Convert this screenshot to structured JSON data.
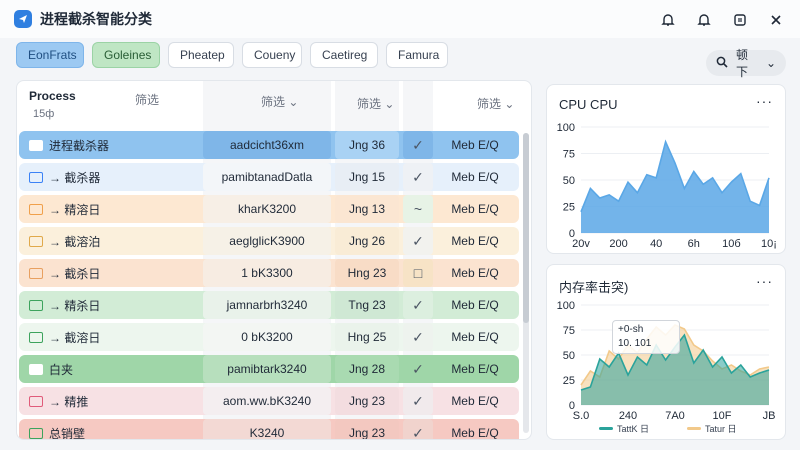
{
  "app": {
    "title": "进程截杀智能分类"
  },
  "tabs": [
    "EonFrats",
    "Goleines",
    "Pheatep",
    "Coueny",
    "Caetireg",
    "Famura"
  ],
  "search": {
    "label": "顿下"
  },
  "table": {
    "header": {
      "process": "Process",
      "process_sub": "15ф",
      "c1": "筛选",
      "c2": "筛选 ⌄",
      "c3": "筛选 ⌄",
      "c4": "筛选 ⌄"
    },
    "rows": [
      {
        "icon": "window-icon",
        "icon_color": "#ffffff",
        "name": "进程截杀器",
        "mid": "aadcicht36xm",
        "date": "Jng 36",
        "check": "✓",
        "status": "Meb E/Q",
        "bg": "#8fc3ef",
        "mid_bg": "#7fb6e8",
        "date_bg": "#a9d2f4",
        "check_bg": "#7fb6e8"
      },
      {
        "icon": "checkbox-icon",
        "icon_color": "#3b82f6",
        "name": "→ 截杀器",
        "mid": "pamibtanadDatla",
        "date": "Jng 15",
        "check": "✓",
        "status": "Meb E/Q",
        "bg": "#e6f0fb",
        "mid_bg": "#f3f6f9",
        "date_bg": "#e8eef5",
        "check_bg": "#eef1f5"
      },
      {
        "icon": "tag-icon",
        "icon_color": "#f0a04b",
        "name": "→ 精溶日",
        "mid": "kharK3200",
        "date": "Jng 13",
        "check": "~",
        "status": "Meb E/Q",
        "bg": "#fde8d2",
        "mid_bg": "#f7efe6",
        "date_bg": "#fbe6d2",
        "check_bg": "#e7f3e6"
      },
      {
        "icon": "tag-icon",
        "icon_color": "#e0a94a",
        "name": "→ 截溶泊",
        "mid": "aeglglicK3900",
        "date": "Jng 26",
        "check": "✓",
        "status": "Meb E/Q",
        "bg": "#fbf0dc",
        "mid_bg": "#f6f1e7",
        "date_bg": "#f9ecd6",
        "check_bg": "#f2f2ee"
      },
      {
        "icon": "square-icon",
        "icon_color": "#e8a060",
        "name": "→ 截杀日",
        "mid": "1 bK3300",
        "date": "Hng 23",
        "check": "□",
        "status": "Meb E/Q",
        "bg": "#fbe3d0",
        "mid_bg": "#f7ece2",
        "date_bg": "#f8dcc6",
        "check_bg": "#f7e3c6"
      },
      {
        "icon": "list-icon",
        "icon_color": "#3da35d",
        "name": "→ 精杀日",
        "mid": "jamnarbrh3240",
        "date": "Tng 23",
        "check": "✓",
        "status": "Meb E/Q",
        "bg": "#d2ecd6",
        "mid_bg": "#e9f2ea",
        "date_bg": "#cfe8d4",
        "check_bg": "#dcefdf"
      },
      {
        "icon": "list-icon",
        "icon_color": "#3da35d",
        "name": "→ 截溶日",
        "mid": "0 bK3200",
        "date": "Hng 25",
        "check": "✓",
        "status": "Meb E/Q",
        "bg": "#edf6ee",
        "mid_bg": "#f3f6f3",
        "date_bg": "#eaf3eb",
        "check_bg": "#eef3ee"
      },
      {
        "icon": "window-icon",
        "icon_color": "#ffffff",
        "name": "白夹",
        "mid": "pamibtark3240",
        "date": "Jng 28",
        "check": "✓",
        "status": "Meb E/Q",
        "bg": "#9fd6a8",
        "mid_bg": "#b7dfbd",
        "date_bg": "#a9dab1",
        "check_bg": "#9fd6a8"
      },
      {
        "icon": "flag-icon",
        "icon_color": "#e05b7a",
        "name": "→ 精推",
        "mid": "aom.ww.bK3240",
        "date": "Jng 23",
        "check": "✓",
        "status": "Meb E/Q",
        "bg": "#f7e1e4",
        "mid_bg": "#f4eef0",
        "date_bg": "#f3dde0",
        "check_bg": "#f1eaec"
      },
      {
        "icon": "flag-icon",
        "icon_color": "#3da35d",
        "name": "总销壁",
        "mid": "K3240",
        "date": "Jng 23",
        "check": "✓",
        "status": "Meb E/Q",
        "bg": "#f6c9c2",
        "mid_bg": "#f3d9d4",
        "date_bg": "#f3c8c0",
        "check_bg": "#f1d3cd"
      }
    ]
  },
  "cpu_card": {
    "title": "CPU CPU",
    "menu": "···"
  },
  "mem_card": {
    "title": "内存率击突)",
    "menu": "···"
  },
  "tooltip": {
    "line1": "+0-sh",
    "line2": "10. 101"
  },
  "chart_data": [
    {
      "type": "area",
      "title": "CPU CPU",
      "x_ticks": [
        "20v",
        "200",
        "40",
        "6h",
        "10б",
        "10¡"
      ],
      "y_ticks": [
        0,
        25,
        50,
        75,
        100
      ],
      "ylim": [
        0,
        100
      ],
      "series": [
        {
          "color": "#5aa7e6",
          "values": [
            20,
            42,
            33,
            36,
            30,
            48,
            38,
            55,
            52,
            86,
            66,
            42,
            58,
            46,
            52,
            38,
            48,
            56,
            30,
            26,
            52
          ]
        }
      ]
    },
    {
      "type": "area",
      "title": "内存率击突)",
      "x_ticks": [
        "S.0",
        "240",
        "7A0",
        "10F",
        "JB"
      ],
      "y_ticks": [
        0,
        25,
        50,
        75,
        100
      ],
      "ylim": [
        0,
        100
      ],
      "series": [
        {
          "name": "TattK 日",
          "color": "#2aa39b",
          "values": [
            15,
            18,
            46,
            38,
            52,
            30,
            48,
            40,
            60,
            45,
            58,
            70,
            42,
            55,
            38,
            48,
            32,
            40,
            28,
            32,
            35
          ]
        },
        {
          "name": "Tatur 日",
          "color": "#f2c98a",
          "values": [
            20,
            34,
            28,
            54,
            46,
            60,
            52,
            66,
            78,
            70,
            80,
            76,
            60,
            54,
            44,
            36,
            40,
            34,
            30,
            36,
            38
          ]
        }
      ]
    }
  ]
}
